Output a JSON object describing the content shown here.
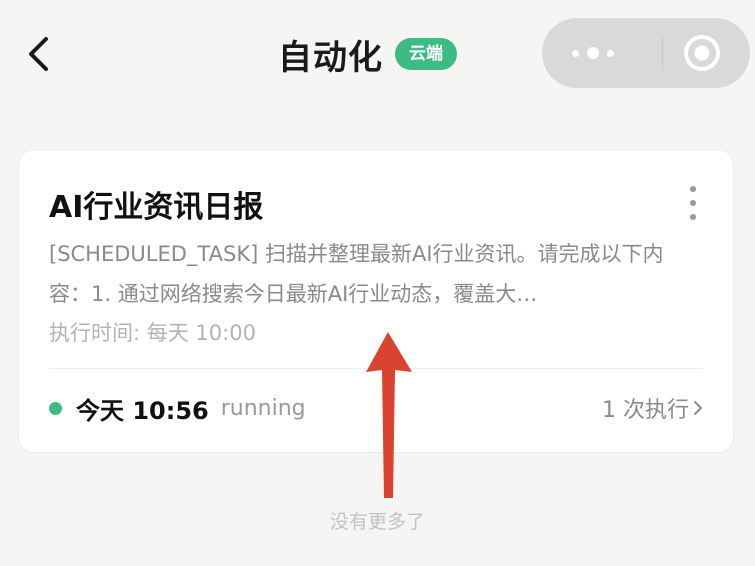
{
  "header": {
    "title": "自动化",
    "badge": "云端"
  },
  "task_card": {
    "title": "AI行业资讯日报",
    "description": "[SCHEDULED_TASK] 扫描并整理最新AI行业资讯。请完成以下内容：1. 通过网络搜索今日最新AI行业动态，覆盖大…",
    "schedule": "执行时间: 每天 10:00",
    "last_run_time": "今天 10:56",
    "run_state": "running",
    "run_count": "1 次执行"
  },
  "footer": {
    "no_more": "没有更多了"
  },
  "colors": {
    "accent": "#3dbb83",
    "annotation_arrow": "#d9432f",
    "background": "#f5f5f3"
  },
  "icons": [
    "back-arrow-icon",
    "more-dots-icon",
    "capsule-menu-icon",
    "record-circle-icon",
    "chevron-right-icon"
  ]
}
